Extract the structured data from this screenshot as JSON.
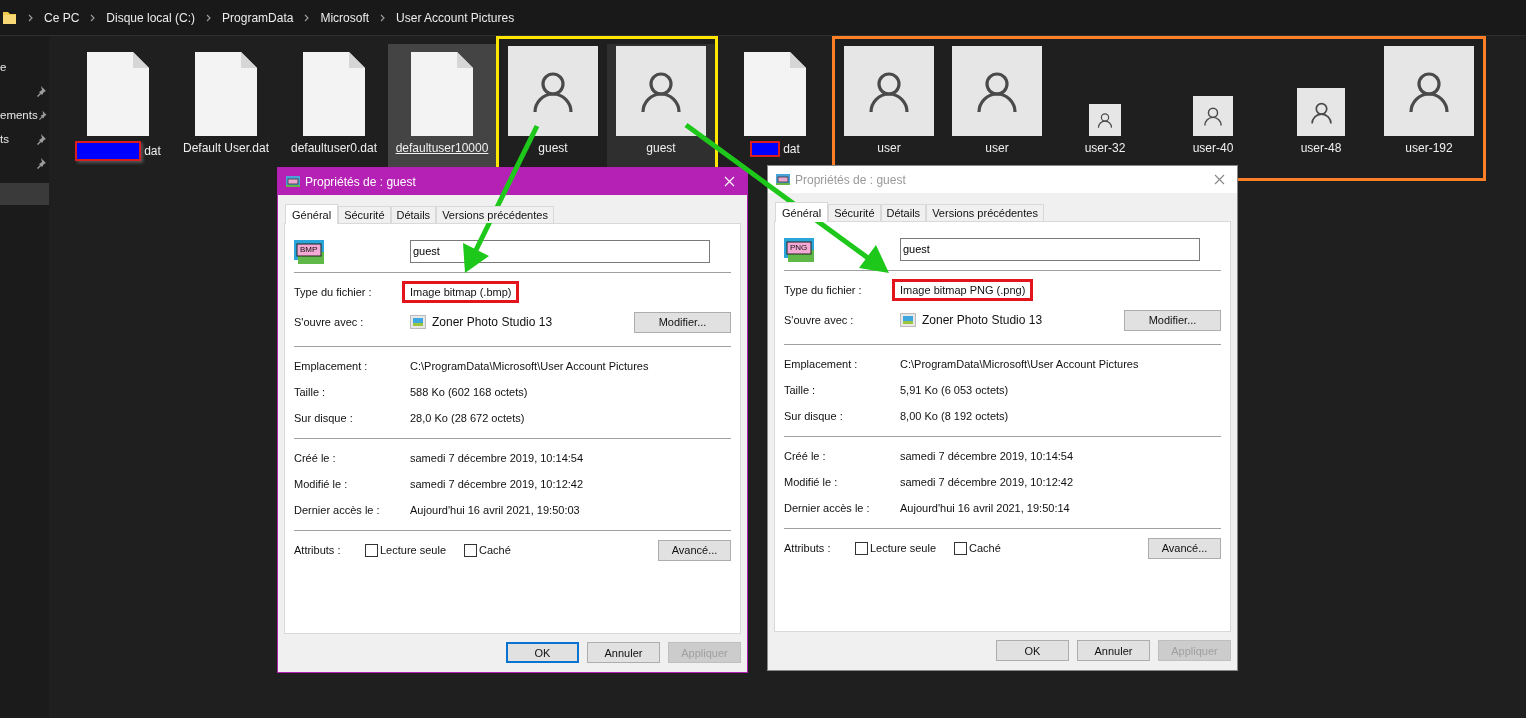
{
  "address_bar": {
    "crumbs": [
      "Ce PC",
      "Disque local (C:)",
      "ProgramData",
      "Microsoft",
      "User Account Pictures"
    ]
  },
  "sidebar": {
    "items": [
      {
        "label": "e",
        "pinned": false,
        "selected": false
      },
      {
        "pinned": true,
        "selected": false
      },
      {
        "label": "ements",
        "pinned": true,
        "selected": false
      },
      {
        "label": "ts",
        "pinned": true,
        "selected": false
      },
      {
        "pinned": true,
        "selected": false
      },
      {
        "pinned": false,
        "selected": true
      }
    ]
  },
  "file_groups": [
    {
      "files": [
        {
          "name": "dat",
          "kind": "document",
          "redacted": true,
          "hovered": false,
          "selected": false
        },
        {
          "name": "Default User.dat",
          "kind": "document",
          "redacted": false,
          "hovered": false,
          "selected": false
        },
        {
          "name": "defaultuser0.dat",
          "kind": "document",
          "redacted": false,
          "hovered": false,
          "selected": false
        },
        {
          "name": "defaultuser10000",
          "kind": "document",
          "redacted": false,
          "hovered": true,
          "selected": false
        }
      ]
    },
    {
      "color": "#ffe600",
      "files": [
        {
          "name": "guest",
          "kind": "avatar",
          "redacted": false,
          "hovered": false,
          "selected": false
        },
        {
          "name": "guest",
          "kind": "avatar",
          "redacted": false,
          "hovered": false,
          "selected": true
        }
      ]
    },
    {
      "files": [
        {
          "name": "dat",
          "kind": "document",
          "redacted": true,
          "hovered": false,
          "selected": false
        }
      ]
    },
    {
      "color": "#ff7f27",
      "files": [
        {
          "name": "user",
          "kind": "avatar",
          "redacted": false,
          "hovered": false,
          "selected": false
        },
        {
          "name": "user",
          "kind": "avatar",
          "redacted": false,
          "hovered": false,
          "selected": false
        },
        {
          "name": "user-32",
          "kind": "avatar32",
          "redacted": false,
          "hovered": false,
          "selected": false
        },
        {
          "name": "user-40",
          "kind": "avatar40",
          "redacted": false,
          "hovered": false,
          "selected": false
        },
        {
          "name": "user-48",
          "kind": "avatar48",
          "redacted": false,
          "hovered": false,
          "selected": false
        },
        {
          "name": "user-192",
          "kind": "avatar",
          "redacted": false,
          "hovered": false,
          "selected": false
        }
      ]
    }
  ],
  "dialogs": [
    {
      "title": "Propriétés de : guest",
      "active": true,
      "tabs": [
        {
          "label": "Général",
          "selected": true
        },
        {
          "label": "Sécurité",
          "selected": false
        },
        {
          "label": "Détails",
          "selected": false
        },
        {
          "label": "Versions précédentes",
          "selected": false
        }
      ],
      "file_icon_label": "BMP",
      "file_name": "guest",
      "file_type": {
        "label": "Type du fichier :",
        "value": "Image bitmap (.bmp)",
        "highlighted": true
      },
      "opens_with": {
        "label": "S'ouvre avec :",
        "app": "Zoner Photo Studio 13",
        "button": "Modifier..."
      },
      "location_rows": [
        {
          "label": "Emplacement :",
          "value": "C:\\ProgramData\\Microsoft\\User Account Pictures"
        },
        {
          "label": "Taille :",
          "value": "588 Ko (602 168 octets)"
        },
        {
          "label": "Sur disque :",
          "value": "28,0 Ko (28 672 octets)"
        }
      ],
      "date_rows": [
        {
          "label": "Créé le :",
          "value": "samedi 7 décembre 2019, 10:14:54"
        },
        {
          "label": "Modifié le :",
          "value": "samedi 7 décembre 2019, 10:12:42"
        },
        {
          "label": "Dernier accès le :",
          "value": "Aujourd'hui 16 avril 2021, 19:50:03"
        }
      ],
      "attributes": {
        "label": "Attributs :",
        "checkboxes": [
          {
            "label": "Lecture seule",
            "checked": false
          },
          {
            "label": "Caché",
            "checked": false
          }
        ],
        "button": "Avancé..."
      },
      "buttons": [
        {
          "label": "OK",
          "default": true,
          "disabled": false
        },
        {
          "label": "Annuler",
          "default": false,
          "disabled": false
        },
        {
          "label": "Appliquer",
          "default": false,
          "disabled": true
        }
      ]
    },
    {
      "title": "Propriétés de : guest",
      "active": false,
      "tabs": [
        {
          "label": "Général",
          "selected": true
        },
        {
          "label": "Sécurité",
          "selected": false
        },
        {
          "label": "Détails",
          "selected": false
        },
        {
          "label": "Versions précédentes",
          "selected": false
        }
      ],
      "file_icon_label": "PNG",
      "file_name": "guest",
      "file_type": {
        "label": "Type du fichier :",
        "value": "Image bitmap PNG (.png)",
        "highlighted": true
      },
      "opens_with": {
        "label": "S'ouvre avec :",
        "app": "Zoner Photo Studio 13",
        "button": "Modifier..."
      },
      "location_rows": [
        {
          "label": "Emplacement :",
          "value": "C:\\ProgramData\\Microsoft\\User Account Pictures"
        },
        {
          "label": "Taille :",
          "value": "5,91 Ko (6 053 octets)"
        },
        {
          "label": "Sur disque :",
          "value": "8,00 Ko (8 192 octets)"
        }
      ],
      "date_rows": [
        {
          "label": "Créé le :",
          "value": "samedi 7 décembre 2019, 10:14:54"
        },
        {
          "label": "Modifié le :",
          "value": "samedi 7 décembre 2019, 10:12:42"
        },
        {
          "label": "Dernier accès le :",
          "value": "Aujourd'hui 16 avril 2021, 19:50:14"
        }
      ],
      "attributes": {
        "label": "Attributs :",
        "checkboxes": [
          {
            "label": "Lecture seule",
            "checked": false
          },
          {
            "label": "Caché",
            "checked": false
          }
        ],
        "button": "Avancé..."
      },
      "buttons": [
        {
          "label": "OK",
          "default": false,
          "disabled": false
        },
        {
          "label": "Annuler",
          "default": false,
          "disabled": false
        },
        {
          "label": "Appliquer",
          "default": false,
          "disabled": true
        }
      ]
    }
  ]
}
